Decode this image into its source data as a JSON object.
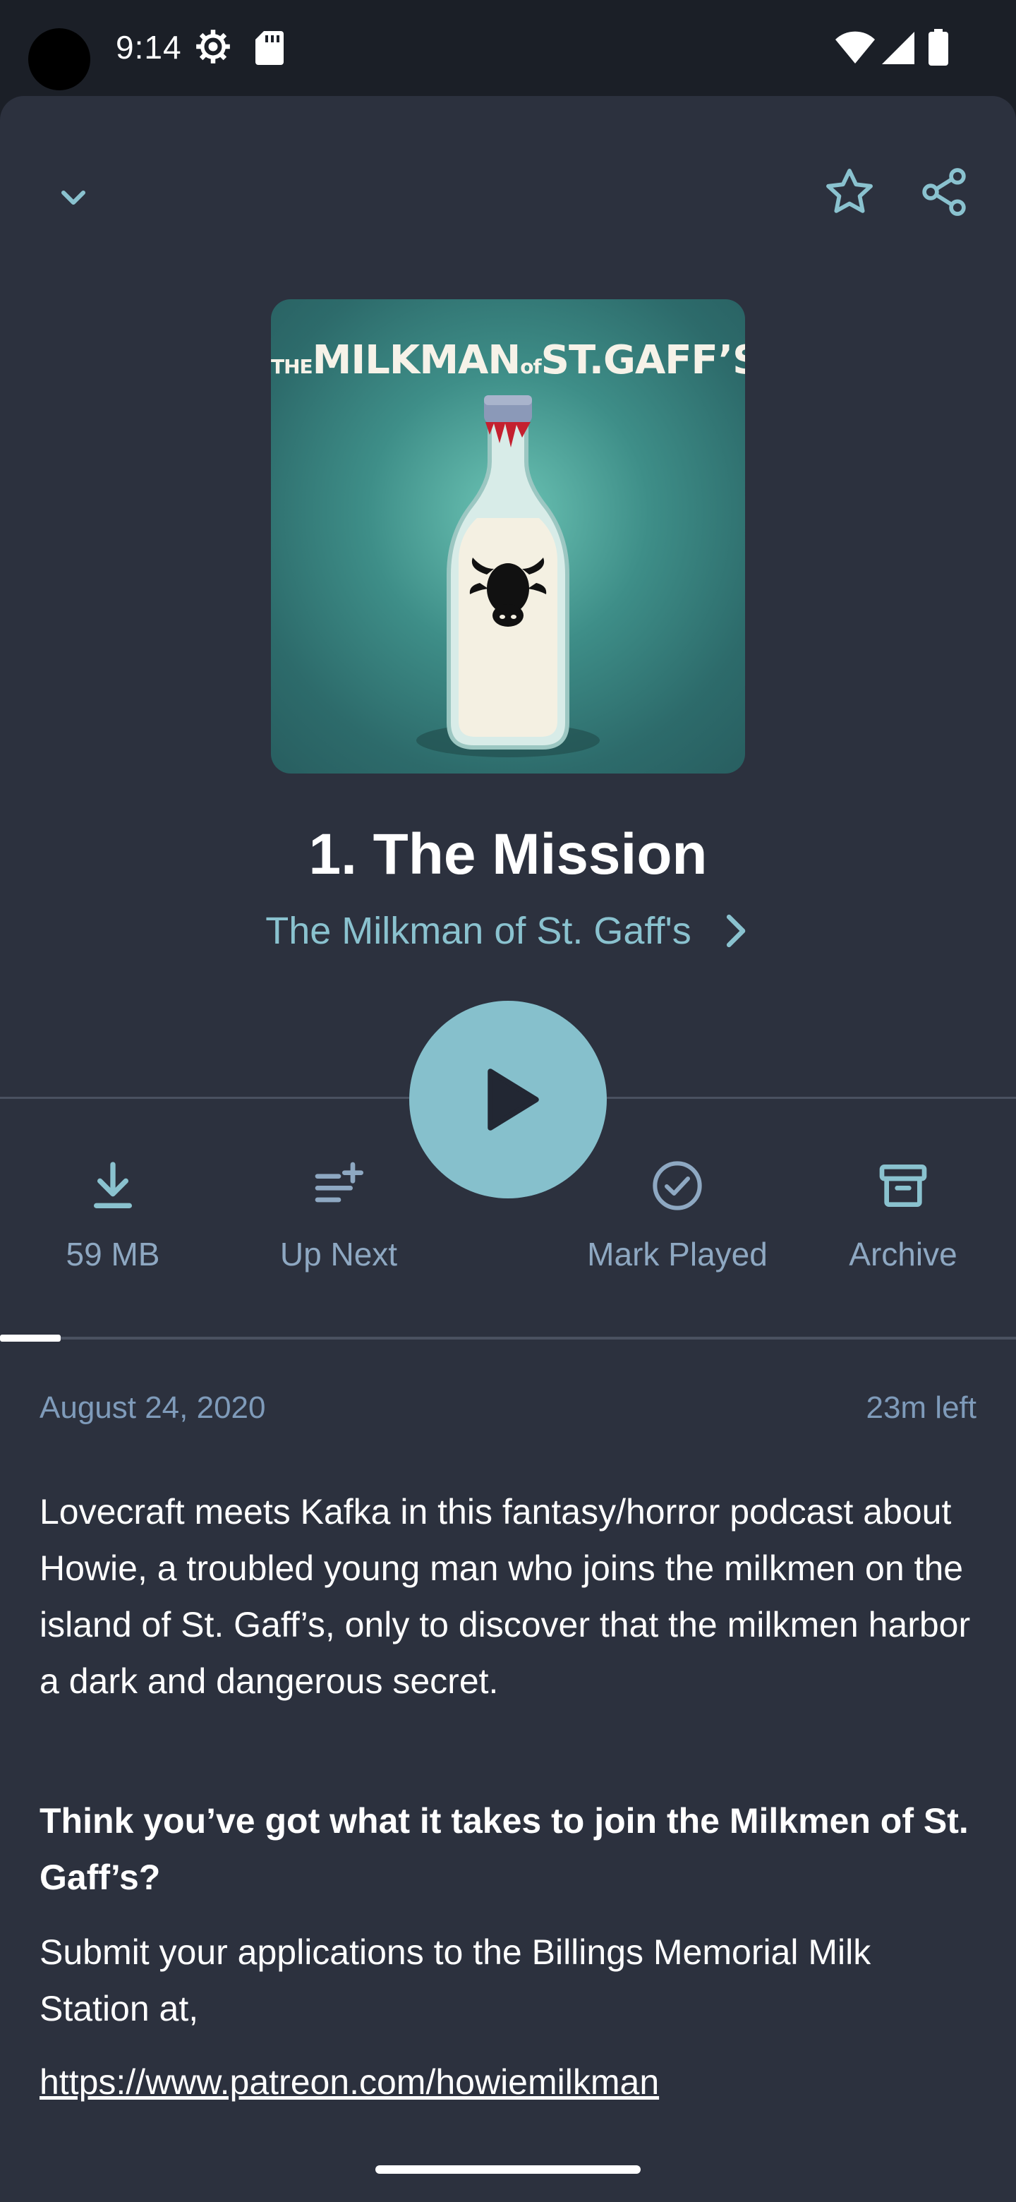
{
  "status_bar": {
    "time": "9:14"
  },
  "toolbar": {},
  "artwork": {
    "title_left": "THE",
    "title_main": "MILKMAN",
    "title_of": "of",
    "title_end": "ST.GAFF’S"
  },
  "episode": {
    "title": "1. The Mission",
    "podcast": "The Milkman of St. Gaff's"
  },
  "actions": [
    {
      "label": "59 MB",
      "icon": "download-icon"
    },
    {
      "label": "Up Next",
      "icon": "playlist-add-icon"
    },
    {
      "label": "Mark Played",
      "icon": "check-circle-icon"
    },
    {
      "label": "Archive",
      "icon": "archive-icon"
    }
  ],
  "progress": {
    "fraction": 0.06
  },
  "meta": {
    "date": "August 24, 2020",
    "time_left": "23m left"
  },
  "description": {
    "p1": "Lovecraft meets Kafka in this fantasy/horror podcast about Howie, a troubled young man who joins the milkmen on the island of St. Gaff’s, only to discover that the milkmen harbor a dark and dangerous secret.",
    "p2": "Think you’ve got what it takes to join the Milkmen of St. Gaff’s?",
    "p3": "Submit your applications to the Billings Memorial Milk Station at,",
    "link": "https://www.patreon.com/howiemilkman"
  },
  "colors": {
    "accent": "#86c0cc",
    "sheet": "#2c313e",
    "muted": "#8ea8c2"
  }
}
